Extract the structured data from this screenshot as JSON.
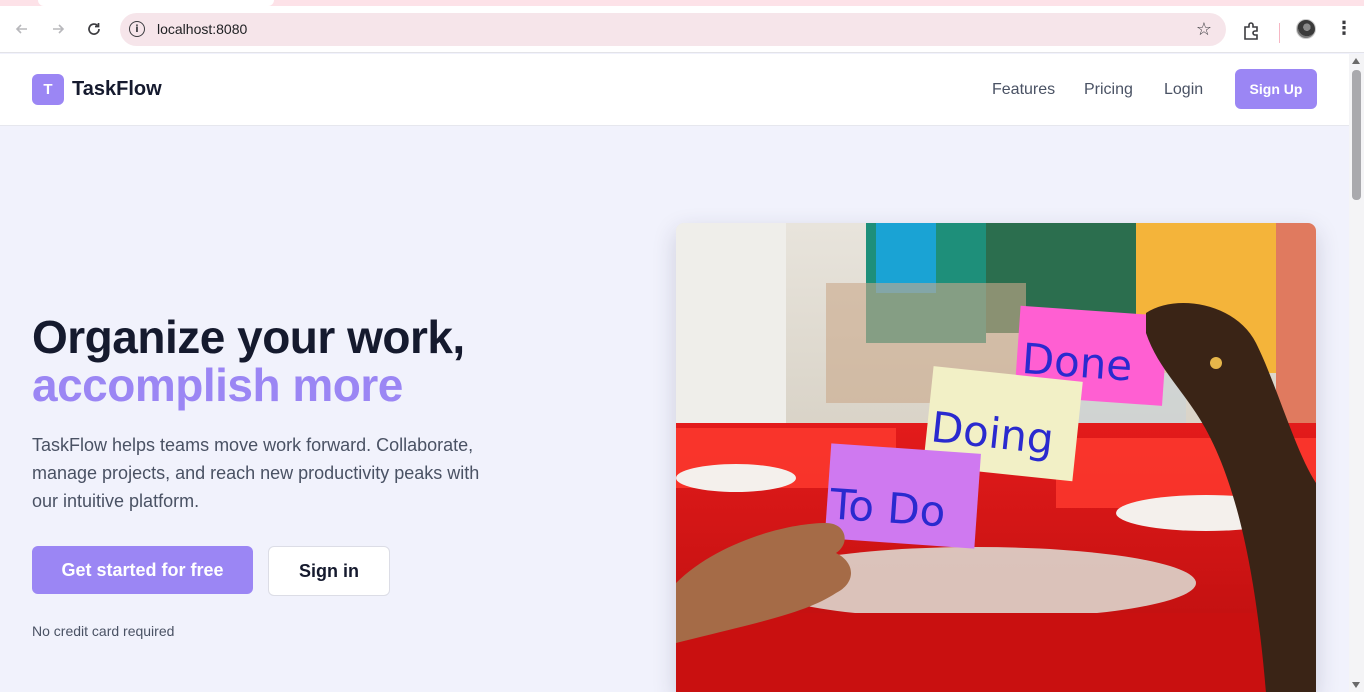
{
  "browser": {
    "url": "localhost:8080",
    "back_icon": "arrow-left-icon",
    "forward_icon": "arrow-right-icon",
    "reload_icon": "reload-icon",
    "info_icon": "info-icon",
    "star_icon": "star-icon",
    "extensions_icon": "puzzle-icon",
    "menu_icon": "kebab-menu-icon"
  },
  "header": {
    "logo_letter": "T",
    "brand": "TaskFlow",
    "nav": [
      "Features",
      "Pricing",
      "Login"
    ],
    "signup_label": "Sign Up"
  },
  "hero": {
    "title_line1": "Organize your work,",
    "title_line2": "accomplish more",
    "description": "TaskFlow helps teams move work forward. Collaborate, manage projects, and reach new productivity peaks with our intuitive platform.",
    "primary_cta": "Get started for free",
    "secondary_cta": "Sign in",
    "note": "No credit card required",
    "image_notes": {
      "todo": "To Do",
      "doing": "Doing",
      "done": "Done"
    }
  },
  "colors": {
    "accent": "#9b86f4",
    "heading": "#151a2e",
    "body_text": "#4a5264",
    "background": "#f1f2fc"
  }
}
